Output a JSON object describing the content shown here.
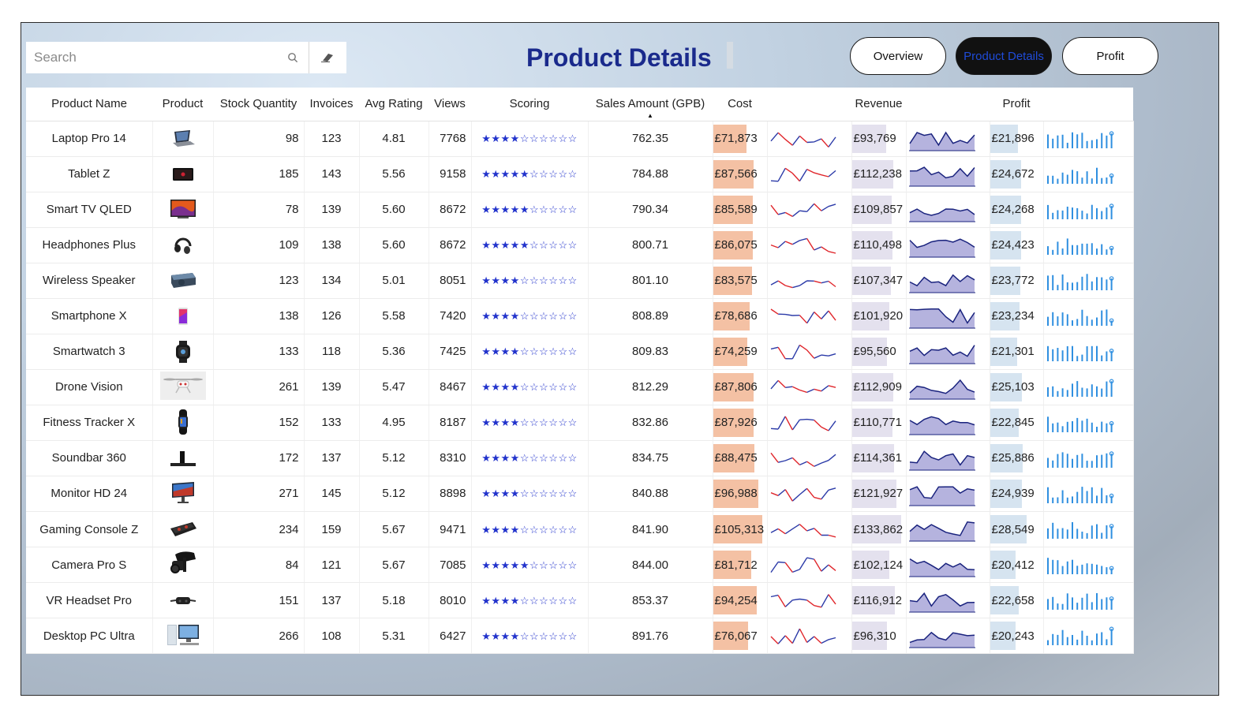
{
  "search": {
    "placeholder": "Search"
  },
  "title": "Product Details",
  "nav": {
    "overview": "Overview",
    "product_details": "Product Details",
    "profit": "Profit"
  },
  "columns": {
    "product_name": "Product Name",
    "product": "Product",
    "stock": "Stock Quantity",
    "invoices": "Invoices",
    "rating": "Avg Rating",
    "views": "Views",
    "scoring": "Scoring",
    "sales": "Sales Amount (GPB)",
    "cost": "Cost",
    "revenue": "Revenue",
    "profit": "Profit"
  },
  "colors": {
    "title": "#1a2a8c",
    "cost_bar": "#f4c1a4",
    "revenue_bar": "#e4e1ee",
    "profit_bar": "#d6e4f0",
    "cost_spark_blue": "#2b3aa8",
    "cost_spark_red": "#e0262b",
    "revenue_spark": "#1a237e",
    "profit_spark": "#2f8fe0",
    "stars": "#2233cc"
  },
  "rows": [
    {
      "name": "Laptop Pro 14",
      "icon": "laptop-icon",
      "stock": "98",
      "invoices": "123",
      "rating": "4.81",
      "views": "7768",
      "stars": 4,
      "sales": "762.35",
      "cost": "£71,873",
      "cost_v": 71873,
      "revenue": "£93,769",
      "revenue_v": 93769,
      "profit": "£21,896",
      "profit_v": 21896
    },
    {
      "name": "Tablet Z",
      "icon": "tablet-icon",
      "stock": "185",
      "invoices": "143",
      "rating": "5.56",
      "views": "9158",
      "stars": 5,
      "sales": "784.88",
      "cost": "£87,566",
      "cost_v": 87566,
      "revenue": "£112,238",
      "revenue_v": 112238,
      "profit": "£24,672",
      "profit_v": 24672
    },
    {
      "name": "Smart TV QLED",
      "icon": "tv-icon",
      "stock": "78",
      "invoices": "139",
      "rating": "5.60",
      "views": "8672",
      "stars": 5,
      "sales": "790.34",
      "cost": "£85,589",
      "cost_v": 85589,
      "revenue": "£109,857",
      "revenue_v": 109857,
      "profit": "£24,268",
      "profit_v": 24268
    },
    {
      "name": "Headphones Plus",
      "icon": "headphones-icon",
      "stock": "109",
      "invoices": "138",
      "rating": "5.60",
      "views": "8672",
      "stars": 5,
      "sales": "800.71",
      "cost": "£86,075",
      "cost_v": 86075,
      "revenue": "£110,498",
      "revenue_v": 110498,
      "profit": "£24,423",
      "profit_v": 24423
    },
    {
      "name": "Wireless Speaker",
      "icon": "speaker-icon",
      "stock": "123",
      "invoices": "134",
      "rating": "5.01",
      "views": "8051",
      "stars": 4,
      "sales": "801.10",
      "cost": "£83,575",
      "cost_v": 83575,
      "revenue": "£107,347",
      "revenue_v": 107347,
      "profit": "£23,772",
      "profit_v": 23772
    },
    {
      "name": "Smartphone X",
      "icon": "smartphone-icon",
      "stock": "138",
      "invoices": "126",
      "rating": "5.58",
      "views": "7420",
      "stars": 4,
      "sales": "808.89",
      "cost": "£78,686",
      "cost_v": 78686,
      "revenue": "£101,920",
      "revenue_v": 101920,
      "profit": "£23,234",
      "profit_v": 23234
    },
    {
      "name": "Smartwatch 3",
      "icon": "smartwatch-icon",
      "stock": "133",
      "invoices": "118",
      "rating": "5.36",
      "views": "7425",
      "stars": 4,
      "sales": "809.83",
      "cost": "£74,259",
      "cost_v": 74259,
      "revenue": "£95,560",
      "revenue_v": 95560,
      "profit": "£21,301",
      "profit_v": 21301
    },
    {
      "name": "Drone Vision",
      "icon": "drone-icon",
      "stock": "261",
      "invoices": "139",
      "rating": "5.47",
      "views": "8467",
      "stars": 4,
      "sales": "812.29",
      "cost": "£87,806",
      "cost_v": 87806,
      "revenue": "£112,909",
      "revenue_v": 112909,
      "profit": "£25,103",
      "profit_v": 25103
    },
    {
      "name": "Fitness Tracker X",
      "icon": "fitness-tracker-icon",
      "stock": "152",
      "invoices": "133",
      "rating": "4.95",
      "views": "8187",
      "stars": 4,
      "sales": "832.86",
      "cost": "£87,926",
      "cost_v": 87926,
      "revenue": "£110,771",
      "revenue_v": 110771,
      "profit": "£22,845",
      "profit_v": 22845
    },
    {
      "name": "Soundbar 360",
      "icon": "soundbar-icon",
      "stock": "172",
      "invoices": "137",
      "rating": "5.12",
      "views": "8310",
      "stars": 4,
      "sales": "834.75",
      "cost": "£88,475",
      "cost_v": 88475,
      "revenue": "£114,361",
      "revenue_v": 114361,
      "profit": "£25,886",
      "profit_v": 25886
    },
    {
      "name": "Monitor HD 24",
      "icon": "monitor-icon",
      "stock": "271",
      "invoices": "145",
      "rating": "5.12",
      "views": "8898",
      "stars": 4,
      "sales": "840.88",
      "cost": "£96,988",
      "cost_v": 96988,
      "revenue": "£121,927",
      "revenue_v": 121927,
      "profit": "£24,939",
      "profit_v": 24939
    },
    {
      "name": "Gaming Console Z",
      "icon": "game-console-icon",
      "stock": "234",
      "invoices": "159",
      "rating": "5.67",
      "views": "9471",
      "stars": 4,
      "sales": "841.90",
      "cost": "£105,313",
      "cost_v": 105313,
      "revenue": "£133,862",
      "revenue_v": 133862,
      "profit": "£28,549",
      "profit_v": 28549
    },
    {
      "name": "Camera Pro S",
      "icon": "camera-icon",
      "stock": "84",
      "invoices": "121",
      "rating": "5.67",
      "views": "7085",
      "stars": 5,
      "sales": "844.00",
      "cost": "£81,712",
      "cost_v": 81712,
      "revenue": "£102,124",
      "revenue_v": 102124,
      "profit": "£20,412",
      "profit_v": 20412
    },
    {
      "name": "VR Headset Pro",
      "icon": "vr-headset-icon",
      "stock": "151",
      "invoices": "137",
      "rating": "5.18",
      "views": "8010",
      "stars": 4,
      "sales": "853.37",
      "cost": "£94,254",
      "cost_v": 94254,
      "revenue": "£116,912",
      "revenue_v": 116912,
      "profit": "£22,658",
      "profit_v": 22658
    },
    {
      "name": "Desktop PC Ultra",
      "icon": "desktop-pc-icon",
      "stock": "266",
      "invoices": "108",
      "rating": "5.31",
      "views": "6427",
      "stars": 4,
      "sales": "891.76",
      "cost": "£76,067",
      "cost_v": 76067,
      "revenue": "£96,310",
      "revenue_v": 96310,
      "profit": "£20,243",
      "profit_v": 20243
    }
  ]
}
